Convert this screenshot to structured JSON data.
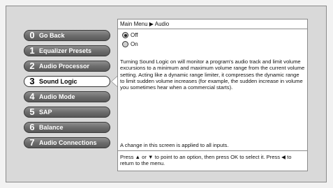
{
  "menu": {
    "items": [
      {
        "num": "0",
        "label": "Go Back"
      },
      {
        "num": "1",
        "label": "Equalizer Presets"
      },
      {
        "num": "2",
        "label": "Audio Processor"
      },
      {
        "num": "3",
        "label": "Sound Logic"
      },
      {
        "num": "4",
        "label": "Audio Mode"
      },
      {
        "num": "5",
        "label": "SAP"
      },
      {
        "num": "6",
        "label": "Balance"
      },
      {
        "num": "7",
        "label": "Audio Connections"
      }
    ],
    "selected_index": 3
  },
  "panel": {
    "breadcrumb": "Main Menu ▶ Audio",
    "options": [
      {
        "label": "Off",
        "selected": true
      },
      {
        "label": "On",
        "selected": false
      }
    ],
    "description": "Turning Sound Logic on will monitor a program's audio track and limit volume excursions to a minimum and maximum volume range from the current volume setting. Acting like a dynamic range limiter, it compresses the dynamic range to limit sudden volume increases (for example, the sudden increase in volume you sometimes hear when a commercial starts).",
    "note": "A change in this screen is applied to all inputs.",
    "help": "Press ▲ or ▼ to point to an option, then press OK to select it. Press ◀ to return to the menu."
  }
}
